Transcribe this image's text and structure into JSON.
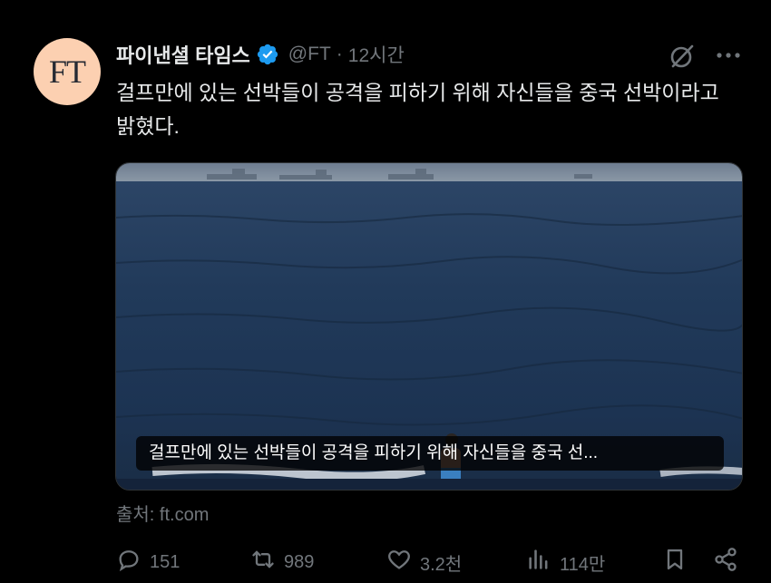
{
  "account": {
    "avatar_text": "FT",
    "display_name": "파이낸셜 타임스",
    "handle": "@FT",
    "separator": "·",
    "time": "12시간",
    "verified_color": "#1d9bf0"
  },
  "tweet": {
    "text": "걸프만에 있는 선박들이 공격을 피하기 위해 자신들을 중국 선박이라고 밝혔다."
  },
  "media": {
    "caption": "걸프만에 있는 선박들이 공격을 피하기 위해 자신들을 중국 선...",
    "source": "출처: ft.com"
  },
  "actions": {
    "replies": "151",
    "reposts": "989",
    "likes": "3.2천",
    "views": "114만"
  },
  "icons": [
    "verified-badge-icon",
    "grok-icon",
    "more-icon",
    "reply-icon",
    "repost-icon",
    "like-icon",
    "views-icon",
    "bookmark-icon",
    "share-icon"
  ]
}
